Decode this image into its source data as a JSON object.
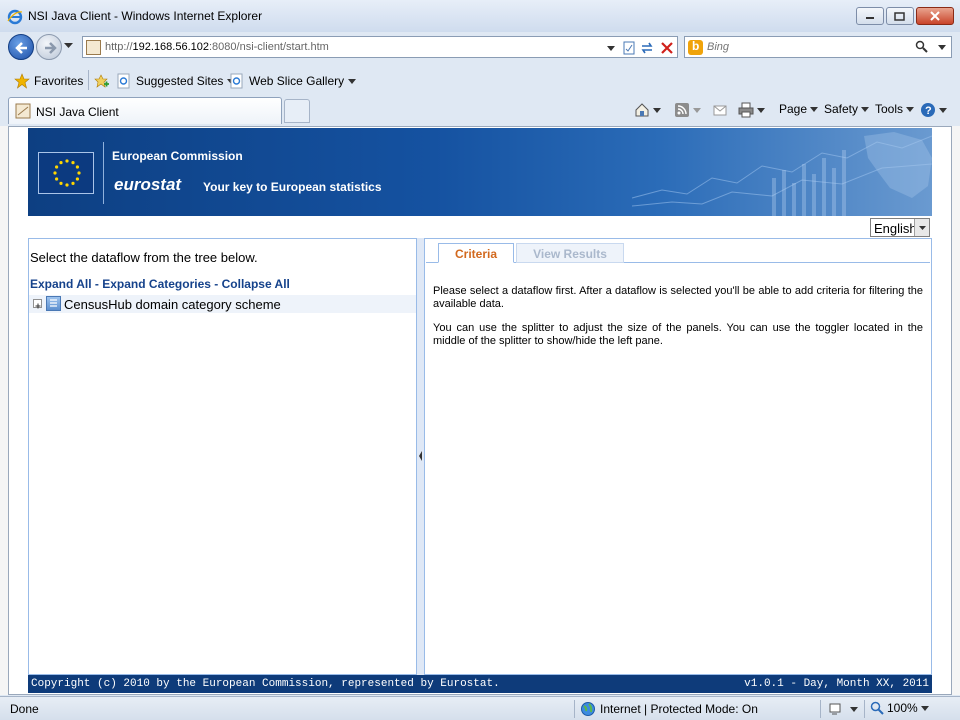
{
  "window": {
    "title": "NSI Java Client - Windows Internet Explorer"
  },
  "address": {
    "url_prefix": "http://",
    "url_host": "192.168.56.102",
    "url_rest": ":8080/nsi-client/start.htm"
  },
  "search": {
    "placeholder": "Bing"
  },
  "favorites": {
    "label": "Favorites",
    "suggested": "Suggested Sites",
    "webslice": "Web Slice Gallery"
  },
  "tab": {
    "title": "NSI Java Client"
  },
  "commandbar": {
    "page": "Page",
    "safety": "Safety",
    "tools": "Tools"
  },
  "banner": {
    "org": "European Commission",
    "brand": "eurostat",
    "tagline": "Your key to European statistics"
  },
  "language": {
    "selected": "English"
  },
  "left": {
    "instruction": "Select the dataflow from the tree below.",
    "expand_all": "Expand All",
    "expand_categories": "Expand Categories",
    "collapse_all": "Collapse All",
    "separator": " - ",
    "tree_root": "CensusHub domain category scheme"
  },
  "right": {
    "tabs": [
      "Criteria",
      "View Results"
    ],
    "para1": "Please select a dataflow first. After a dataflow is selected you'll be able to add criteria for filtering the available data.",
    "para2": "You can use the splitter to adjust the size of the panels. You can use the toggler located in the middle of the splitter to show/hide the left pane."
  },
  "footer": {
    "copyright": "Copyright (c) 2010 by the European Commission, represented by Eurostat.",
    "version": "v1.0.1 - Day, Month XX, 2011"
  },
  "status": {
    "text": "Done",
    "zone": "Internet | Protected Mode: On",
    "zoom": "100%"
  },
  "colors": {
    "accent": "#15428b",
    "active_tab": "#d2691e",
    "footer_bg": "#0e3b7a"
  }
}
